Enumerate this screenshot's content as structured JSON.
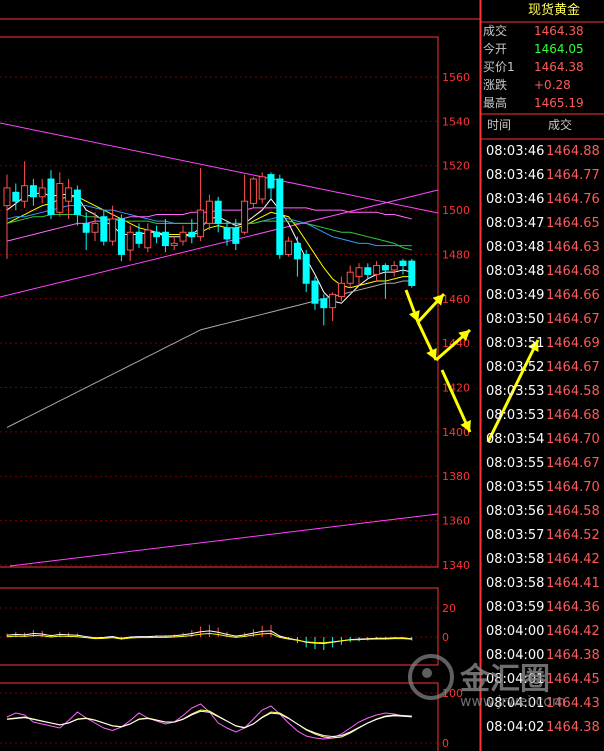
{
  "symbol": "XAU",
  "name": "现货黄金",
  "quote": [
    {
      "label": "成交",
      "value": "1464.38",
      "color": "#ff5a5a"
    },
    {
      "label": "今开",
      "value": "1464.05",
      "color": "#33ff33"
    },
    {
      "label": "买价1",
      "value": "1464.38",
      "color": "#ff5a5a"
    },
    {
      "label": "涨跌",
      "value": "+0.28",
      "color": "#ff5a5a"
    },
    {
      "label": "最高",
      "value": "1465.19",
      "color": "#ff5a5a"
    }
  ],
  "ticks_header": {
    "time": "时间",
    "price": "成交"
  },
  "ticks": [
    {
      "time": "08:03:46",
      "price": "1464.88"
    },
    {
      "time": "08:03:46",
      "price": "1464.77"
    },
    {
      "time": "08:03:46",
      "price": "1464.76"
    },
    {
      "time": "08:03:47",
      "price": "1464.65"
    },
    {
      "time": "08:03:48",
      "price": "1464.63"
    },
    {
      "time": "08:03:48",
      "price": "1464.68"
    },
    {
      "time": "08:03:49",
      "price": "1464.66"
    },
    {
      "time": "08:03:50",
      "price": "1464.67"
    },
    {
      "time": "08:03:51",
      "price": "1464.69"
    },
    {
      "time": "08:03:52",
      "price": "1464.67"
    },
    {
      "time": "08:03:53",
      "price": "1464.58"
    },
    {
      "time": "08:03:53",
      "price": "1464.68"
    },
    {
      "time": "08:03:54",
      "price": "1464.70"
    },
    {
      "time": "08:03:55",
      "price": "1464.67"
    },
    {
      "time": "08:03:55",
      "price": "1464.70"
    },
    {
      "time": "08:03:56",
      "price": "1464.58"
    },
    {
      "time": "08:03:57",
      "price": "1464.52"
    },
    {
      "time": "08:03:58",
      "price": "1464.42"
    },
    {
      "time": "08:03:58",
      "price": "1464.41"
    },
    {
      "time": "08:03:59",
      "price": "1464.36"
    },
    {
      "time": "08:04:00",
      "price": "1464.42"
    },
    {
      "time": "08:04:00",
      "price": "1464.38"
    },
    {
      "time": "08:04:01",
      "price": "1464.45"
    },
    {
      "time": "08:04:01",
      "price": "1464.43"
    },
    {
      "time": "08:04:02",
      "price": "1464.38"
    }
  ],
  "watermark": {
    "text": "金汇圈",
    "url": "www.jrwei.com"
  },
  "colors": {
    "up": "#ff5050",
    "down": "#00ffff",
    "grid": "#7a0000",
    "axis": "#ff3333",
    "ma5": "#ffffff",
    "ma10": "#ffff00",
    "ma20": "#3399ff",
    "ma30": "#33cc33",
    "ma60": "#ff66ff",
    "ma120": "#aaaaaa",
    "trend": "#ff44ff",
    "arrow": "#ffff00"
  },
  "chart_data": {
    "type": "candlestick",
    "yticks": [
      1560,
      1540,
      1520,
      1500,
      1480,
      1460,
      1440,
      1420,
      1400,
      1380,
      1360,
      1340
    ],
    "ylim": [
      1336,
      1568
    ],
    "candles": [
      {
        "o": 1502,
        "c": 1510,
        "h": 1516,
        "l": 1478
      },
      {
        "o": 1508,
        "c": 1504,
        "h": 1512,
        "l": 1500
      },
      {
        "o": 1504,
        "c": 1511,
        "h": 1522,
        "l": 1501
      },
      {
        "o": 1511,
        "c": 1506,
        "h": 1514,
        "l": 1502
      },
      {
        "o": 1506,
        "c": 1510,
        "h": 1514,
        "l": 1503
      },
      {
        "o": 1514,
        "c": 1498,
        "h": 1518,
        "l": 1496
      },
      {
        "o": 1499,
        "c": 1512,
        "h": 1517,
        "l": 1497
      },
      {
        "o": 1504,
        "c": 1510,
        "h": 1514,
        "l": 1496
      },
      {
        "o": 1509,
        "c": 1498,
        "h": 1511,
        "l": 1493
      },
      {
        "o": 1494,
        "c": 1490,
        "h": 1499,
        "l": 1482
      },
      {
        "o": 1490,
        "c": 1494,
        "h": 1499,
        "l": 1486
      },
      {
        "o": 1497,
        "c": 1486,
        "h": 1500,
        "l": 1484
      },
      {
        "o": 1486,
        "c": 1496,
        "h": 1502,
        "l": 1484
      },
      {
        "o": 1496,
        "c": 1480,
        "h": 1498,
        "l": 1477
      },
      {
        "o": 1482,
        "c": 1490,
        "h": 1493,
        "l": 1477
      },
      {
        "o": 1490,
        "c": 1485,
        "h": 1494,
        "l": 1483
      },
      {
        "o": 1483,
        "c": 1491,
        "h": 1494,
        "l": 1481
      },
      {
        "o": 1490,
        "c": 1488,
        "h": 1493,
        "l": 1485
      },
      {
        "o": 1490,
        "c": 1484,
        "h": 1496,
        "l": 1481
      },
      {
        "o": 1484,
        "c": 1485,
        "h": 1488,
        "l": 1482
      },
      {
        "o": 1486,
        "c": 1490,
        "h": 1493,
        "l": 1484
      },
      {
        "o": 1490,
        "c": 1488,
        "h": 1496,
        "l": 1485
      },
      {
        "o": 1488,
        "c": 1500,
        "h": 1519,
        "l": 1486
      },
      {
        "o": 1494,
        "c": 1504,
        "h": 1507,
        "l": 1491
      },
      {
        "o": 1504,
        "c": 1494,
        "h": 1506,
        "l": 1490
      },
      {
        "o": 1492,
        "c": 1487,
        "h": 1495,
        "l": 1484
      },
      {
        "o": 1492,
        "c": 1485,
        "h": 1496,
        "l": 1482
      },
      {
        "o": 1490,
        "c": 1504,
        "h": 1516,
        "l": 1489
      },
      {
        "o": 1503,
        "c": 1514,
        "h": 1515,
        "l": 1501
      },
      {
        "o": 1505,
        "c": 1515,
        "h": 1517,
        "l": 1503
      },
      {
        "o": 1516,
        "c": 1510,
        "h": 1517,
        "l": 1505
      },
      {
        "o": 1514,
        "c": 1480,
        "h": 1516,
        "l": 1478
      },
      {
        "o": 1480,
        "c": 1486,
        "h": 1488,
        "l": 1479
      },
      {
        "o": 1485,
        "c": 1478,
        "h": 1488,
        "l": 1470
      },
      {
        "o": 1480,
        "c": 1467,
        "h": 1482,
        "l": 1463
      },
      {
        "o": 1468,
        "c": 1458,
        "h": 1470,
        "l": 1455
      },
      {
        "o": 1460,
        "c": 1456,
        "h": 1462,
        "l": 1448
      },
      {
        "o": 1456,
        "c": 1462,
        "h": 1463,
        "l": 1450
      },
      {
        "o": 1461,
        "c": 1467,
        "h": 1470,
        "l": 1459
      },
      {
        "o": 1467,
        "c": 1472,
        "h": 1475,
        "l": 1465
      },
      {
        "o": 1470,
        "c": 1474,
        "h": 1476,
        "l": 1466
      },
      {
        "o": 1474,
        "c": 1471,
        "h": 1476,
        "l": 1469
      },
      {
        "o": 1471,
        "c": 1475,
        "h": 1477,
        "l": 1468
      },
      {
        "o": 1475,
        "c": 1473,
        "h": 1476,
        "l": 1460
      },
      {
        "o": 1473,
        "c": 1475,
        "h": 1477,
        "l": 1470
      },
      {
        "o": 1477,
        "c": 1475,
        "h": 1478,
        "l": 1471
      },
      {
        "o": 1477,
        "c": 1466,
        "h": 1478,
        "l": 1465
      }
    ],
    "ma_lines": [
      {
        "key": "ma5",
        "values": [
          1500,
          1503,
          1506,
          1507,
          1508,
          1506,
          1507,
          1507,
          1506,
          1500,
          1498,
          1495,
          1493,
          1489,
          1489,
          1489,
          1490,
          1490,
          1488,
          1488,
          1488,
          1489,
          1492,
          1496,
          1497,
          1495,
          1493,
          1494,
          1497,
          1500,
          1505,
          1500,
          1494,
          1486,
          1478,
          1471,
          1463,
          1459,
          1458,
          1462,
          1466,
          1469,
          1471,
          1472,
          1472,
          1473,
          1472
        ]
      },
      {
        "key": "ma10",
        "values": [
          1494,
          1496,
          1498,
          1500,
          1502,
          1503,
          1505,
          1506,
          1506,
          1504,
          1502,
          1500,
          1498,
          1496,
          1494,
          1492,
          1491,
          1490,
          1489,
          1489,
          1489,
          1489,
          1490,
          1492,
          1493,
          1492,
          1492,
          1493,
          1495,
          1497,
          1499,
          1498,
          1497,
          1492,
          1486,
          1480,
          1474,
          1469,
          1466,
          1465,
          1466,
          1467,
          1468,
          1468,
          1469,
          1470,
          1470
        ]
      },
      {
        "key": "ma20",
        "values": [
          1496,
          1497,
          1497,
          1498,
          1499,
          1500,
          1501,
          1502,
          1502,
          1502,
          1501,
          1500,
          1500,
          1499,
          1498,
          1497,
          1496,
          1495,
          1495,
          1494,
          1494,
          1494,
          1494,
          1494,
          1494,
          1494,
          1494,
          1494,
          1494,
          1495,
          1496,
          1497,
          1496,
          1495,
          1494,
          1492,
          1490,
          1488,
          1487,
          1486,
          1485,
          1485,
          1484,
          1484,
          1484,
          1484,
          1484
        ]
      },
      {
        "key": "ma30",
        "values": [
          1494,
          1495,
          1496,
          1497,
          1497,
          1498,
          1498,
          1498,
          1498,
          1497,
          1497,
          1496,
          1496,
          1495,
          1495,
          1495,
          1495,
          1494,
          1494,
          1494,
          1494,
          1494,
          1494,
          1494,
          1494,
          1494,
          1494,
          1494,
          1494,
          1495,
          1495,
          1495,
          1495,
          1494,
          1494,
          1493,
          1492,
          1491,
          1490,
          1490,
          1489,
          1488,
          1487,
          1486,
          1485,
          1483,
          1482
        ]
      },
      {
        "key": "ma60",
        "values": [
          1486,
          1487,
          1488,
          1489,
          1490,
          1491,
          1492,
          1493,
          1494,
          1494,
          1495,
          1495,
          1496,
          1496,
          1497,
          1497,
          1497,
          1498,
          1498,
          1498,
          1498,
          1499,
          1499,
          1499,
          1500,
          1500,
          1500,
          1500,
          1501,
          1501,
          1501,
          1501,
          1501,
          1501,
          1501,
          1500,
          1500,
          1500,
          1500,
          1499,
          1499,
          1499,
          1499,
          1498,
          1498,
          1497,
          1496
        ]
      },
      {
        "key": "ma120",
        "values": [
          1402,
          1404,
          1406,
          1408,
          1410,
          1412,
          1414,
          1416,
          1418,
          1420,
          1422,
          1424,
          1426,
          1428,
          1430,
          1432,
          1434,
          1436,
          1438,
          1440,
          1442,
          1444,
          1446,
          1447,
          1448,
          1449,
          1450,
          1451,
          1452,
          1453,
          1454,
          1455,
          1456,
          1457,
          1458,
          1459,
          1460,
          1461,
          1462,
          1463,
          1464,
          1465,
          1466,
          1467,
          1467,
          1468,
          1468
        ]
      }
    ],
    "indicator1": {
      "yticks": [
        20,
        0
      ],
      "values": [
        0.4,
        0.6,
        0.5,
        0.8,
        0.7,
        0.3,
        0.6,
        0.5,
        0.4,
        0.1,
        -0.2,
        -0.1,
        0.1,
        -0.3,
        0.0,
        0.1,
        0.1,
        0.2,
        0.2,
        0.3,
        0.5,
        0.8,
        1.2,
        1.4,
        1.1,
        0.6,
        0.2,
        0.5,
        0.9,
        1.3,
        1.4,
        0.2,
        -0.3,
        -0.7,
        -1.2,
        -1.4,
        -1.5,
        -1.2,
        -0.9,
        -0.6,
        -0.5,
        -0.4,
        -0.3,
        -0.3,
        -0.2,
        -0.2,
        -0.4
      ]
    },
    "indicator2": {
      "yticks": [
        100,
        0
      ],
      "k": [
        52,
        60,
        56,
        42,
        38,
        34,
        30,
        45,
        62,
        50,
        40,
        30,
        25,
        32,
        45,
        60,
        50,
        44,
        38,
        42,
        55,
        70,
        78,
        62,
        40,
        30,
        22,
        30,
        48,
        66,
        74,
        58,
        40,
        24,
        14,
        10,
        8,
        10,
        18,
        30,
        42,
        50,
        56,
        60,
        58,
        54,
        52
      ],
      "d": [
        48,
        50,
        52,
        48,
        44,
        40,
        36,
        40,
        48,
        50,
        46,
        40,
        34,
        32,
        38,
        48,
        50,
        46,
        42,
        42,
        48,
        58,
        66,
        64,
        54,
        44,
        34,
        30,
        38,
        52,
        62,
        60,
        50,
        38,
        26,
        18,
        12,
        10,
        12,
        20,
        30,
        40,
        48,
        54,
        56,
        55,
        54
      ]
    },
    "annotations": {
      "arrows": 4
    }
  }
}
